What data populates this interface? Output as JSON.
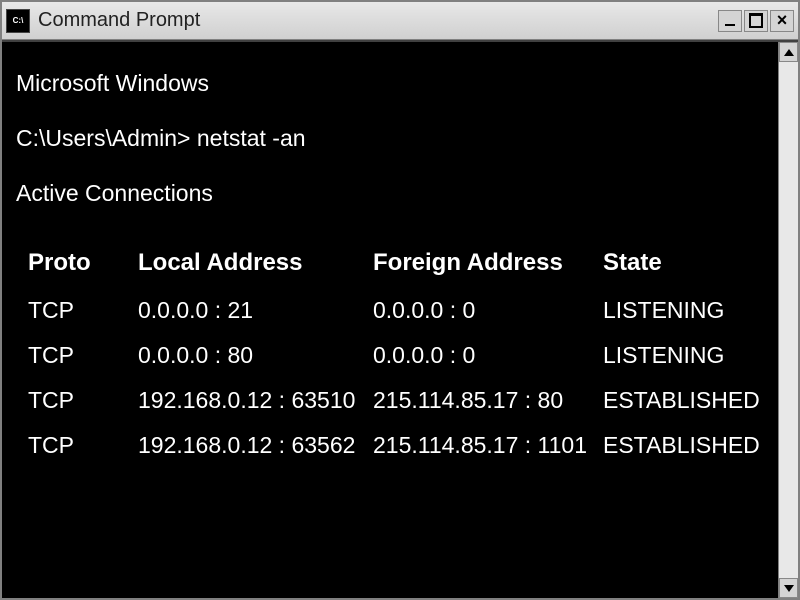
{
  "titlebar": {
    "title": "Command Prompt",
    "icon_label": "C:\\"
  },
  "terminal": {
    "os_line": "Microsoft Windows",
    "prompt": "C:\\Users\\Admin>",
    "command": "netstat -an",
    "section_title": "Active Connections",
    "headers": {
      "proto": "Proto",
      "local": "Local Address",
      "foreign": "Foreign Address",
      "state": "State"
    },
    "rows": [
      {
        "proto": "TCP",
        "local": "0.0.0.0 : 21",
        "foreign": "0.0.0.0 : 0",
        "state": "LISTENING"
      },
      {
        "proto": "TCP",
        "local": "0.0.0.0 : 80",
        "foreign": "0.0.0.0 : 0",
        "state": "LISTENING"
      },
      {
        "proto": "TCP",
        "local": "192.168.0.12 : 63510",
        "foreign": "215.114.85.17 : 80",
        "state": "ESTABLISHED"
      },
      {
        "proto": "TCP",
        "local": "192.168.0.12 : 63562",
        "foreign": "215.114.85.17 : 1101",
        "state": "ESTABLISHED"
      }
    ]
  }
}
